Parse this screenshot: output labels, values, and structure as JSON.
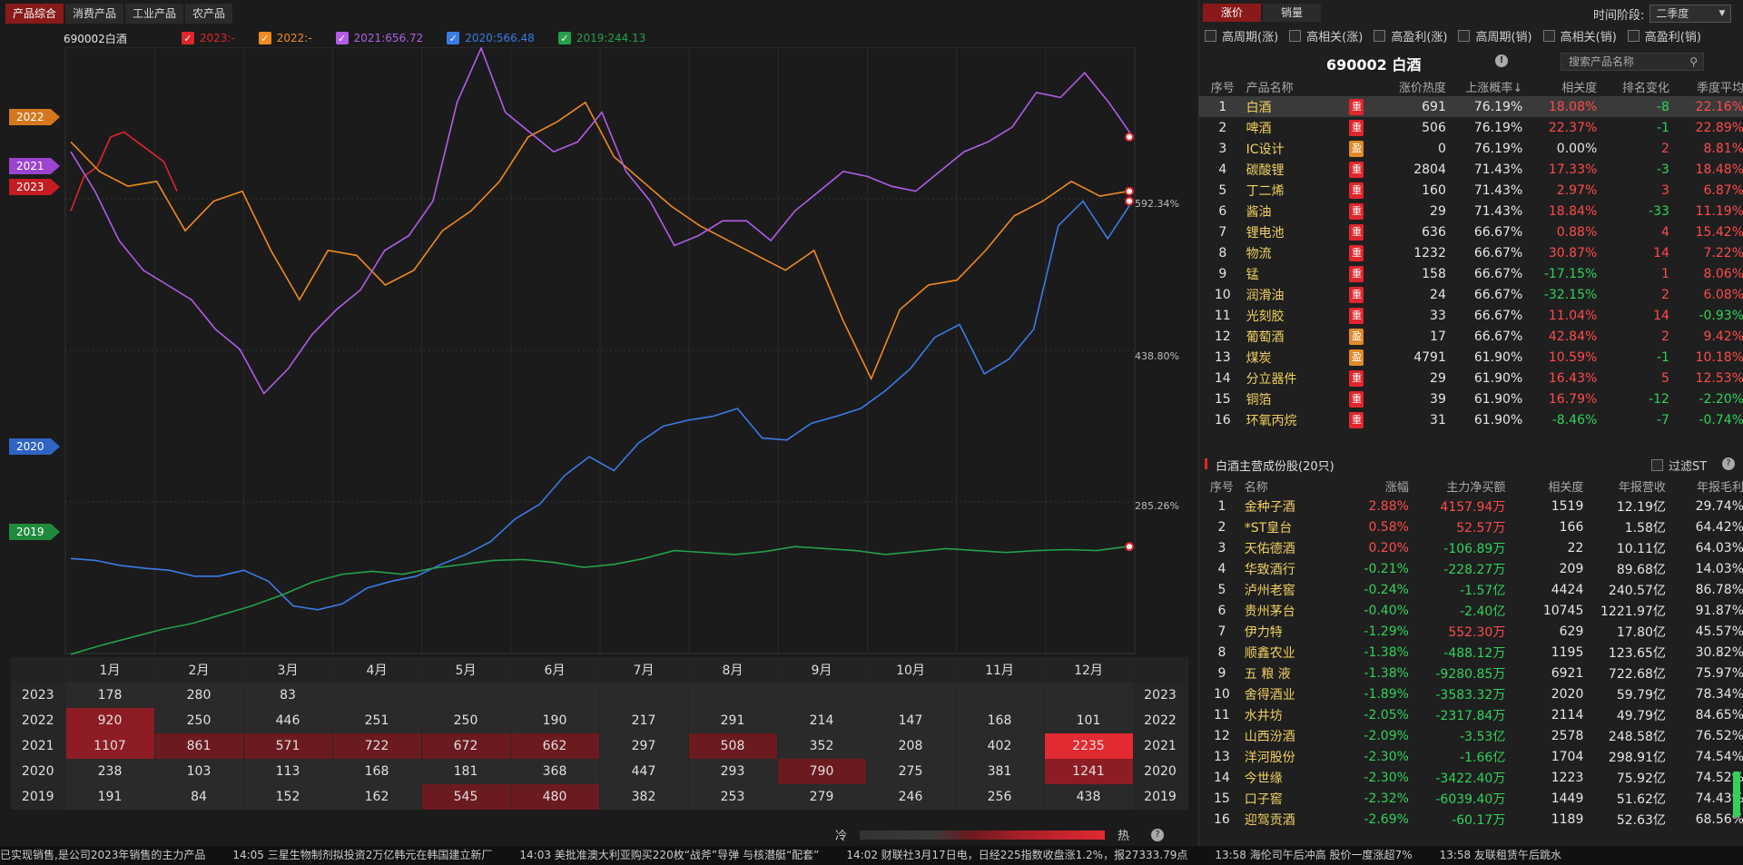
{
  "top_tabs": [
    "产品综合",
    "消费产品",
    "工业产品",
    "农产品"
  ],
  "legend": {
    "product": "690002白酒",
    "items": [
      {
        "label": "2023:-",
        "color": "#e0262c"
      },
      {
        "label": "2022:-",
        "color": "#f28a1e"
      },
      {
        "label": "2021:656.72",
        "color": "#b25de8"
      },
      {
        "label": "2020:566.48",
        "color": "#3b7be8"
      },
      {
        "label": "2019:244.13",
        "color": "#25a04a"
      }
    ]
  },
  "year_tags": [
    {
      "label": "2022",
      "color": "#d4781f"
    },
    {
      "label": "2021",
      "color": "#9a44d0"
    },
    {
      "label": "2023",
      "color": "#c41c22"
    },
    {
      "label": "2020",
      "color": "#2f64c4"
    },
    {
      "label": "2019",
      "color": "#1f8a3c"
    }
  ],
  "pct_labels": [
    "592.34%",
    "438.80%",
    "285.26%"
  ],
  "chart_data": {
    "type": "line",
    "title": "690002白酒",
    "x": [
      "1月",
      "2月",
      "3月",
      "4月",
      "5月",
      "6月",
      "7月",
      "8月",
      "9月",
      "10月",
      "11月",
      "12月"
    ],
    "ylim": [
      131.7,
      745.9
    ],
    "yticks": [
      285.26,
      438.8,
      592.34
    ],
    "series": [
      {
        "name": "2023",
        "color": "#e0262c",
        "values": [
          580,
          615,
          625,
          655,
          660,
          650,
          640,
          630,
          600
        ]
      },
      {
        "name": "2022",
        "color": "#f28a1e",
        "values": [
          650,
          620,
          605,
          610,
          560,
          590,
          600,
          540,
          490,
          540,
          535,
          505,
          520,
          560,
          580,
          610,
          655,
          670,
          690,
          635,
          610,
          585,
          565,
          550,
          535,
          520,
          540,
          470,
          410,
          480,
          505,
          510,
          540,
          575,
          590,
          610,
          595,
          600
        ]
      },
      {
        "name": "2021",
        "color": "#b25de8",
        "values": [
          640,
          600,
          550,
          520,
          505,
          490,
          460,
          440,
          395,
          420,
          455,
          480,
          500,
          540,
          555,
          590,
          690,
          745,
          680,
          660,
          640,
          650,
          680,
          620,
          590,
          545,
          555,
          570,
          570,
          550,
          580,
          600,
          620,
          615,
          605,
          600,
          620,
          640,
          650,
          665,
          700,
          695,
          720,
          690,
          655
        ]
      },
      {
        "name": "2020",
        "color": "#3b7be8",
        "values": [
          228,
          226,
          221,
          218,
          216,
          210,
          210,
          216,
          205,
          180,
          176,
          182,
          198,
          205,
          210,
          222,
          232,
          245,
          268,
          283,
          312,
          331,
          317,
          345,
          362,
          368,
          372,
          380,
          350,
          348,
          365,
          372,
          380,
          398,
          420,
          452,
          465,
          415,
          430,
          460,
          565,
          590,
          552,
          590
        ]
      },
      {
        "name": "2019",
        "color": "#25a04a",
        "values": [
          131,
          140,
          148,
          156,
          162,
          171,
          180,
          191,
          204,
          212,
          215,
          212,
          218,
          222,
          226,
          227,
          224,
          219,
          222,
          228,
          236,
          234,
          232,
          235,
          240,
          238,
          236,
          232,
          235,
          238,
          236,
          234,
          236,
          237,
          236,
          240
        ]
      }
    ]
  },
  "heat_table": {
    "months": [
      "1月",
      "2月",
      "3月",
      "4月",
      "5月",
      "6月",
      "7月",
      "8月",
      "9月",
      "10月",
      "11月",
      "12月"
    ],
    "rows": [
      {
        "year": "2023",
        "values": [
          "178",
          "280",
          "83",
          "",
          "",
          "",
          "",
          "",
          "",
          "",
          "",
          ""
        ],
        "levels": [
          0,
          0,
          0,
          0,
          0,
          0,
          0,
          0,
          0,
          0,
          0,
          0
        ]
      },
      {
        "year": "2022",
        "values": [
          "920",
          "250",
          "446",
          "251",
          "250",
          "190",
          "217",
          "291",
          "214",
          "147",
          "168",
          "101"
        ],
        "levels": [
          2,
          0,
          0,
          0,
          0,
          0,
          0,
          0,
          0,
          0,
          0,
          0
        ]
      },
      {
        "year": "2021",
        "values": [
          "1107",
          "861",
          "571",
          "722",
          "672",
          "662",
          "297",
          "508",
          "352",
          "208",
          "402",
          "2235"
        ],
        "levels": [
          2,
          1,
          1,
          1,
          1,
          1,
          0,
          1,
          0,
          0,
          0,
          4
        ]
      },
      {
        "year": "2020",
        "values": [
          "238",
          "103",
          "113",
          "168",
          "181",
          "368",
          "447",
          "293",
          "790",
          "275",
          "381",
          "1241"
        ],
        "levels": [
          0,
          0,
          0,
          0,
          0,
          0,
          0,
          0,
          1,
          0,
          0,
          2
        ]
      },
      {
        "year": "2019",
        "values": [
          "191",
          "84",
          "152",
          "162",
          "545",
          "480",
          "382",
          "253",
          "279",
          "246",
          "256",
          "438"
        ],
        "levels": [
          0,
          0,
          0,
          0,
          1,
          1,
          0,
          0,
          0,
          0,
          0,
          0
        ]
      }
    ]
  },
  "scale": {
    "cold": "冷",
    "hot": "热",
    "help": "?"
  },
  "ticker": [
    "已实现销售,是公司2023年销售的主力产品",
    "14:05 三星生物制剂拟投资2万亿韩元在韩国建立新厂",
    "14:03 美批准澳大利亚购买220枚“战斧”导弹 与核潜艇“配套”",
    "14:02 财联社3月17日电，日经225指数收盘涨1.2%，报27333.79点",
    "13:58 海伦司午后冲高 股价一度涨超7%",
    "13:58 友联租赁午后跳水"
  ],
  "right": {
    "tabs": [
      "涨价",
      "销量"
    ],
    "period_label": "时间阶段:",
    "period_value": "二季度",
    "filters": [
      "高周期(涨)",
      "高相关(涨)",
      "高盈利(涨)",
      "高周期(销)",
      "高相关(销)",
      "高盈利(销)"
    ],
    "product_code_name": "690002  白酒",
    "info_icon": "!",
    "search_placeholder": "搜索产品名称",
    "table1_headers": [
      "序号",
      "产品名称",
      "",
      "涨价热度",
      "上涨概率↓",
      "相关度",
      "排名变化",
      "季度平均"
    ],
    "table1": [
      [
        "1",
        "白酒",
        "重",
        "691",
        "76.19%",
        "18.08%",
        "-8",
        "22.16%"
      ],
      [
        "2",
        "啤酒",
        "重",
        "506",
        "76.19%",
        "22.37%",
        "-1",
        "22.89%"
      ],
      [
        "3",
        "IC设计",
        "盈",
        "0",
        "76.19%",
        "0.00%",
        "2",
        "8.81%"
      ],
      [
        "4",
        "碳酸锂",
        "重",
        "2804",
        "71.43%",
        "17.33%",
        "-3",
        "18.48%"
      ],
      [
        "5",
        "丁二烯",
        "重",
        "160",
        "71.43%",
        "2.97%",
        "3",
        "6.87%"
      ],
      [
        "6",
        "酱油",
        "重",
        "29",
        "71.43%",
        "18.84%",
        "-33",
        "11.19%"
      ],
      [
        "7",
        "锂电池",
        "重",
        "636",
        "66.67%",
        "0.88%",
        "4",
        "15.42%"
      ],
      [
        "8",
        "物流",
        "重",
        "1232",
        "66.67%",
        "30.87%",
        "14",
        "7.22%"
      ],
      [
        "9",
        "锰",
        "重",
        "158",
        "66.67%",
        "-17.15%",
        "1",
        "8.06%"
      ],
      [
        "10",
        "润滑油",
        "重",
        "24",
        "66.67%",
        "-32.15%",
        "2",
        "6.08%"
      ],
      [
        "11",
        "光刻胶",
        "重",
        "33",
        "66.67%",
        "11.04%",
        "14",
        "-0.93%"
      ],
      [
        "12",
        "葡萄酒",
        "盈",
        "17",
        "66.67%",
        "42.84%",
        "2",
        "9.42%"
      ],
      [
        "13",
        "煤炭",
        "盈",
        "4791",
        "61.90%",
        "10.59%",
        "-1",
        "10.18%"
      ],
      [
        "14",
        "分立器件",
        "重",
        "29",
        "61.90%",
        "16.43%",
        "5",
        "12.53%"
      ],
      [
        "15",
        "铜箔",
        "重",
        "39",
        "61.90%",
        "16.79%",
        "-12",
        "-2.20%"
      ],
      [
        "16",
        "环氧丙烷",
        "重",
        "31",
        "61.90%",
        "-8.46%",
        "-7",
        "-0.74%"
      ]
    ],
    "section_title": "白酒主营成份股(20只)",
    "filter_st": "过滤ST",
    "help": "?",
    "table2_headers": [
      "序号",
      "名称",
      "涨幅",
      "主力净买额",
      "相关度",
      "年报营收",
      "年报毛利"
    ],
    "table2": [
      [
        "1",
        "金种子酒",
        "2.88%",
        "4157.94万",
        "1519",
        "12.19亿",
        "29.74%"
      ],
      [
        "2",
        "*ST皇台",
        "0.58%",
        "52.57万",
        "166",
        "1.58亿",
        "64.42%"
      ],
      [
        "3",
        "天佑德酒",
        "0.20%",
        "-106.89万",
        "22",
        "10.11亿",
        "64.03%"
      ],
      [
        "4",
        "华致酒行",
        "-0.21%",
        "-228.27万",
        "209",
        "89.68亿",
        "14.03%"
      ],
      [
        "5",
        "泸州老窖",
        "-0.24%",
        "-1.57亿",
        "4424",
        "240.57亿",
        "86.78%"
      ],
      [
        "6",
        "贵州茅台",
        "-0.40%",
        "-2.40亿",
        "10745",
        "1221.97亿",
        "91.87%"
      ],
      [
        "7",
        "伊力特",
        "-1.29%",
        "552.30万",
        "629",
        "17.80亿",
        "45.57%"
      ],
      [
        "8",
        "顺鑫农业",
        "-1.38%",
        "-488.12万",
        "1195",
        "123.65亿",
        "30.82%"
      ],
      [
        "9",
        "五 粮 液",
        "-1.38%",
        "-9280.85万",
        "6921",
        "722.68亿",
        "75.97%"
      ],
      [
        "10",
        "舍得酒业",
        "-1.89%",
        "-3583.32万",
        "2020",
        "59.79亿",
        "78.34%"
      ],
      [
        "11",
        "水井坊",
        "-2.05%",
        "-2317.84万",
        "2114",
        "49.79亿",
        "84.65%"
      ],
      [
        "12",
        "山西汾酒",
        "-2.09%",
        "-3.53亿",
        "2578",
        "248.58亿",
        "76.52%"
      ],
      [
        "13",
        "洋河股份",
        "-2.30%",
        "-1.66亿",
        "1704",
        "298.91亿",
        "74.54%"
      ],
      [
        "14",
        "今世缘",
        "-2.30%",
        "-3422.40万",
        "1223",
        "75.92亿",
        "74.52%"
      ],
      [
        "15",
        "口子窖",
        "-2.32%",
        "-6039.40万",
        "1449",
        "51.62亿",
        "74.43%"
      ],
      [
        "16",
        "迎驾贡酒",
        "-2.69%",
        "-60.17万",
        "1189",
        "52.63亿",
        "68.56%"
      ]
    ]
  }
}
